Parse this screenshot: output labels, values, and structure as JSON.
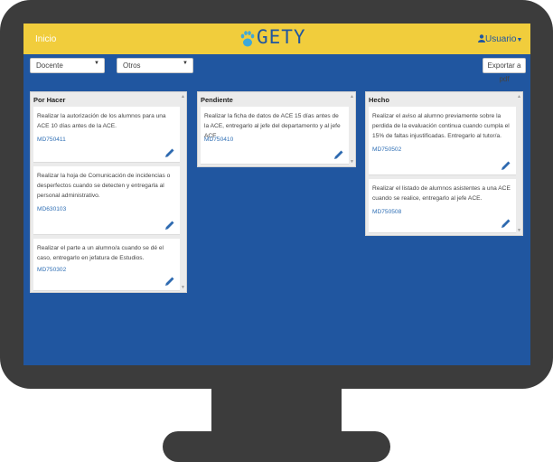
{
  "header": {
    "home_label": "Inicio",
    "logo_text": "GETY",
    "user_label": "Usuario",
    "brand_color": "#f1cd3c",
    "accent_color": "#2056a0"
  },
  "filters": {
    "docente": "Docente",
    "otros": "Otros",
    "export_label": "Exportar a pdf"
  },
  "columns": [
    {
      "title": "Por Hacer",
      "cards": [
        {
          "text": "Realizar la autorización de los alumnos para una ACE 10 días antes de la ACE.",
          "code": "MD750411"
        },
        {
          "text": "Realizar la hoja de Comunicación de incidencias o desperfectos cuando se detecten y entregarla al personal administrativo.",
          "code": "MD630103"
        },
        {
          "text": "Realizar el parte a un alumno/a cuando se dé el caso, entregarlo en jefatura de Estudios.",
          "code": "MD750302"
        }
      ]
    },
    {
      "title": "Pendiente",
      "cards": [
        {
          "text": "Realizar la ficha de datos de ACE 15 días antes de la ACE, entregarlo al jefe del departamento y al jefe ACE.",
          "code": "MD750410"
        }
      ]
    },
    {
      "title": "Hecho",
      "cards": [
        {
          "text": "Realizar el aviso al alumno previamente sobre la perdida de la evaluación continua cuando cumpla el 15% de faltas injustificadas. Entregarlo al tutor/a.",
          "code": "MD750502"
        },
        {
          "text": "Realizar el listado de alumnos asistentes a una ACE cuando se realice, entregarlo al jefe ACE.",
          "code": "MD750508"
        }
      ]
    }
  ]
}
